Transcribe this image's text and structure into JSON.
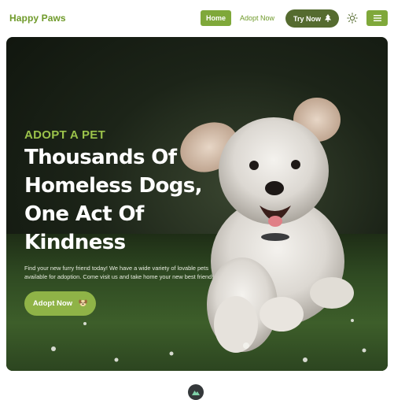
{
  "navbar": {
    "brand": "Happy Paws",
    "home_label": "Home",
    "adopt_label": "Adopt Now",
    "try_label": "Try Now",
    "try_icon": "tree-icon",
    "theme_icon": "sun-icon",
    "menu_icon": "hamburger-menu-icon"
  },
  "hero": {
    "kicker": "ADOPT A PET",
    "headline_lines": [
      "Thousands Of",
      "Homeless Dogs,",
      "One Act Of",
      "Kindness"
    ],
    "blurb_lines": [
      "Find your new furry friend today! We have a wide variety of lovable pets",
      "available for adoption. Come visit us and take home your new best friend!"
    ],
    "cta_label": "Adopt Now",
    "cta_icon": "dog-face-icon",
    "image": "fluffy-white-dog-running-on-grass"
  },
  "footer": {
    "logo_icon": "mountain-logo-icon"
  },
  "colors": {
    "brand_green": "#6f9a2a",
    "button_green": "#7fa83a",
    "dark_olive": "#556b2f",
    "kicker_green": "#9bc24a",
    "cta_green": "#8fb347"
  }
}
